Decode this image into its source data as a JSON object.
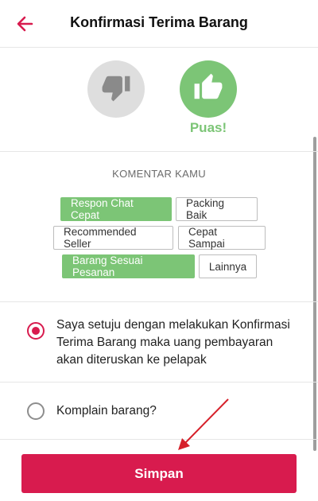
{
  "header": {
    "title": "Konfirmasi Terima Barang"
  },
  "rating": {
    "selected_label": "Puas!",
    "selected": "thumbs-up"
  },
  "comments": {
    "heading": "KOMENTAR KAMU",
    "tags": [
      {
        "label": "Respon Chat Cepat",
        "selected": true
      },
      {
        "label": "Packing Baik",
        "selected": false
      },
      {
        "label": "Recommended Seller",
        "selected": false
      },
      {
        "label": "Cepat Sampai",
        "selected": false
      },
      {
        "label": "Barang Sesuai Pesanan",
        "selected": true
      },
      {
        "label": "Lainnya",
        "selected": false
      }
    ]
  },
  "options": [
    {
      "label": "Saya setuju dengan melakukan Konfirmasi Terima Barang maka uang pembayaran akan diteruskan ke pelapak",
      "checked": true
    },
    {
      "label": "Komplain barang?",
      "checked": false
    }
  ],
  "actions": {
    "save_label": "Simpan"
  },
  "colors": {
    "accent": "#d81b4e",
    "positive": "#7cc576",
    "neutral": "#dedede"
  }
}
